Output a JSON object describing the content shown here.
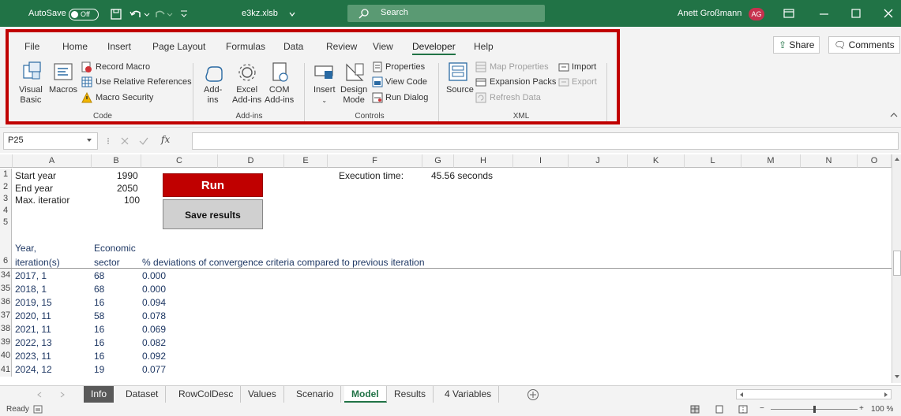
{
  "titlebar": {
    "autosave_label": "AutoSave",
    "autosave_state": "Off",
    "filename": "e3kz.xlsb",
    "search_placeholder": "Search",
    "user_name": "Anett Großmann",
    "user_initials": "AG"
  },
  "ribbon": {
    "tabs": [
      "File",
      "Home",
      "Insert",
      "Page Layout",
      "Formulas",
      "Data",
      "Review",
      "View",
      "Developer",
      "Help"
    ],
    "active_tab": "Developer",
    "share_label": "Share",
    "comments_label": "Comments",
    "groups": {
      "code": {
        "label": "Code",
        "visual_basic_1": "Visual",
        "visual_basic_2": "Basic",
        "macros": "Macros",
        "record_macro": "Record Macro",
        "relative_refs": "Use Relative References",
        "macro_security": "Macro Security"
      },
      "addins": {
        "label": "Add-ins",
        "addins_1": "Add-",
        "addins_2": "ins",
        "excel_addins_1": "Excel",
        "excel_addins_2": "Add-ins",
        "com_addins_1": "COM",
        "com_addins_2": "Add-ins"
      },
      "controls": {
        "label": "Controls",
        "insert": "Insert",
        "design_mode_1": "Design",
        "design_mode_2": "Mode",
        "properties": "Properties",
        "view_code": "View Code",
        "run_dialog": "Run Dialog"
      },
      "xml": {
        "label": "XML",
        "source": "Source",
        "map_properties": "Map Properties",
        "expansion_packs": "Expansion Packs",
        "refresh_data": "Refresh Data",
        "import": "Import",
        "export": "Export"
      }
    }
  },
  "formula_bar": {
    "name_box": "P25",
    "fx_symbol": "fx",
    "value": ""
  },
  "grid": {
    "columns": [
      "A",
      "B",
      "C",
      "D",
      "E",
      "F",
      "G",
      "H",
      "I",
      "J",
      "K",
      "L",
      "M",
      "N",
      "O"
    ],
    "rows": [
      "1",
      "2",
      "3",
      "4",
      "5",
      "6",
      "34",
      "35",
      "36",
      "37",
      "38",
      "39",
      "40",
      "41"
    ],
    "cells": {
      "a1": "Start year",
      "b1": "1990",
      "a2": "End year",
      "b2": "2050",
      "a3": "Max. iteratior",
      "b3": "100",
      "a5": "Year,",
      "b5": "Economic",
      "a6": "iteration(s)",
      "b6": "sector",
      "c6": "% deviations of convergence criteria compared to previous iteration",
      "f1": "Execution time:",
      "g1": "45.56 seconds"
    },
    "data_rows": [
      {
        "year": "2017, 1",
        "sector": "68",
        "dev": "0.000"
      },
      {
        "year": "2018, 1",
        "sector": "68",
        "dev": "0.000"
      },
      {
        "year": "2019, 15",
        "sector": "16",
        "dev": "0.094"
      },
      {
        "year": "2020, 11",
        "sector": "58",
        "dev": "0.078"
      },
      {
        "year": "2021, 11",
        "sector": "16",
        "dev": "0.069"
      },
      {
        "year": "2022, 13",
        "sector": "16",
        "dev": "0.082"
      },
      {
        "year": "2023, 11",
        "sector": "16",
        "dev": "0.092"
      },
      {
        "year": "2024, 12",
        "sector": "19",
        "dev": "0.077"
      }
    ],
    "run_button": "Run",
    "save_button": "Save results"
  },
  "sheets": {
    "tabs": [
      "Info",
      "Dataset",
      "RowColDesc",
      "Values",
      "Scenario",
      "Model",
      "Results",
      "4 Variables"
    ],
    "active": "Model"
  },
  "status": {
    "ready": "Ready",
    "zoom": "100 %"
  },
  "colors": {
    "excel_green": "#217346",
    "highlight_red": "#c00000",
    "run_button": "#c00000",
    "save_button": "#d0d0d0"
  }
}
